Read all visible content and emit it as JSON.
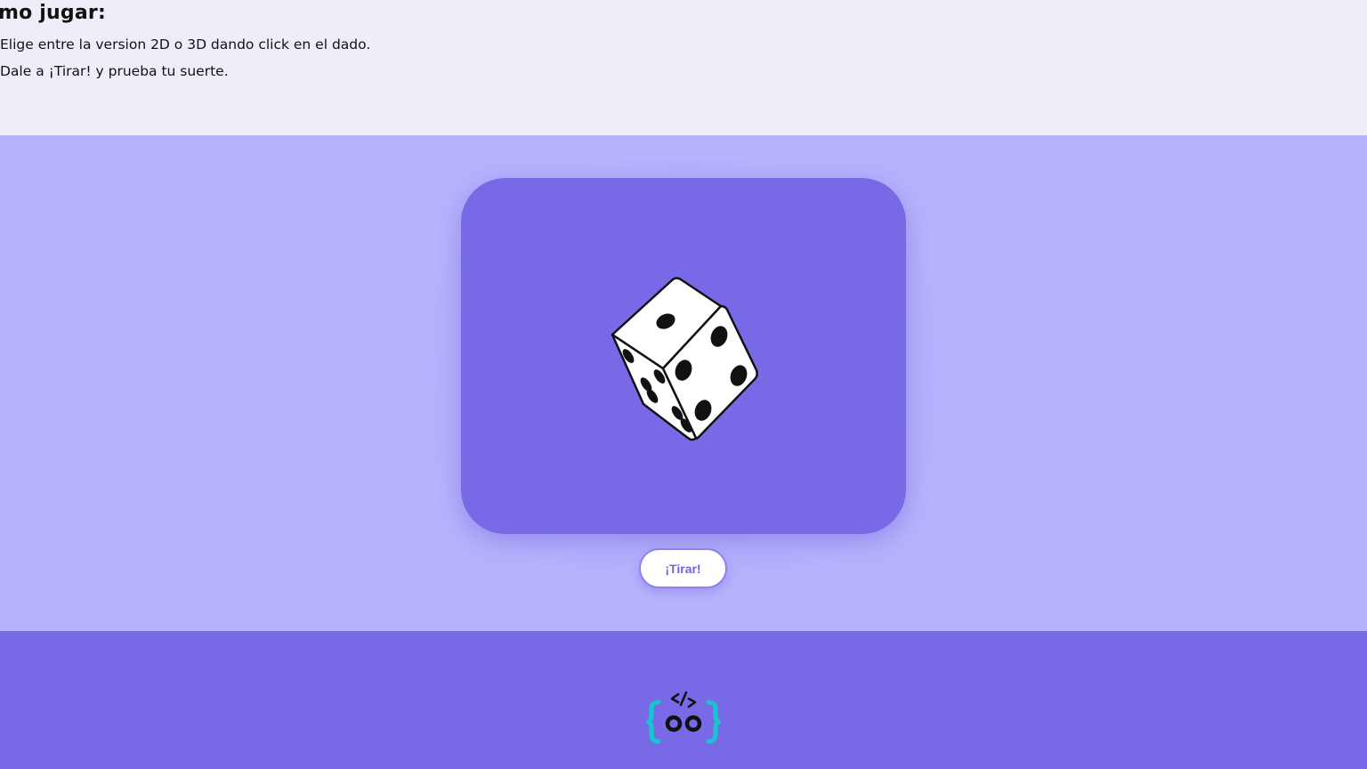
{
  "instructions": {
    "heading": "mo jugar:",
    "step1": "Elige entre la version 2D o 3D dando click en el dado.",
    "step2": "Dale a ¡Tirar! y prueba tu suerte."
  },
  "game": {
    "dice_icon": "dice-3d-icon",
    "roll_label": "¡Tirar!"
  },
  "footer": {
    "logo_icon": "code-braces-logo-icon"
  },
  "colors": {
    "page_top_bg": "#efeef8",
    "game_bg": "#b6b2fc",
    "accent": "#7869e6",
    "button_text": "#7162e2",
    "logo_teal": "#16c6cf"
  }
}
